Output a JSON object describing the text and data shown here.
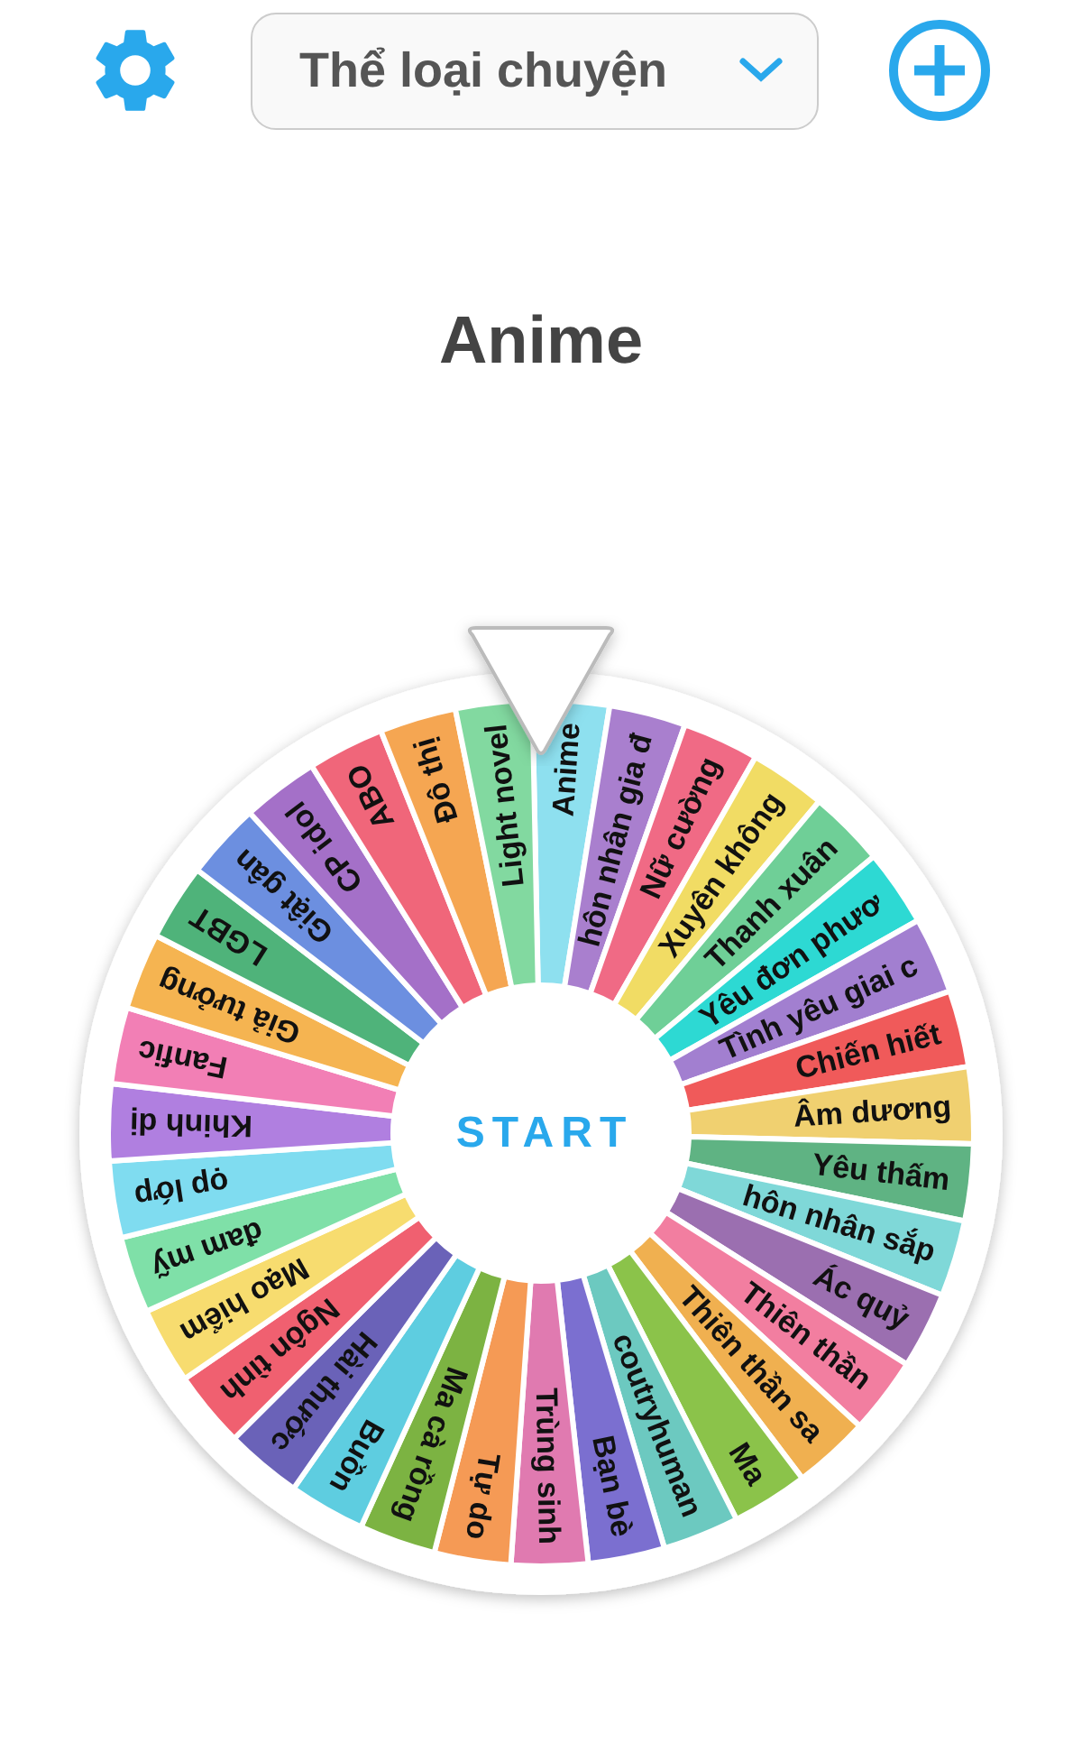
{
  "header": {
    "dropdown": {
      "label": "Thể loại chuyện"
    }
  },
  "result": "Anime",
  "wheel": {
    "start": "START",
    "segments": [
      {
        "label": "Anime",
        "color": "#8ee0ef"
      },
      {
        "label": "hôn nhân gia đ",
        "color": "#a97fce"
      },
      {
        "label": "Nữ cường",
        "color": "#f06a85"
      },
      {
        "label": "Xuyên không",
        "color": "#f1dc64"
      },
      {
        "label": "Thanh xuân",
        "color": "#6fcf97"
      },
      {
        "label": "Yêu đơn phươ",
        "color": "#2dd9d3"
      },
      {
        "label": "Tình yêu giai c",
        "color": "#a27fd0"
      },
      {
        "label": "Chiến hiết",
        "color": "#f05a5a"
      },
      {
        "label": "Âm dương",
        "color": "#f0d070"
      },
      {
        "label": "Yêu thấm",
        "color": "#5fb383"
      },
      {
        "label": "hôn nhân sắp",
        "color": "#7fd8d8"
      },
      {
        "label": "Ác quỷ",
        "color": "#9b6fb0"
      },
      {
        "label": "Thiên thần",
        "color": "#f27ea0"
      },
      {
        "label": "Thiên thần sa",
        "color": "#f0b050"
      },
      {
        "label": "Ma",
        "color": "#8bc34a"
      },
      {
        "label": "coutryhuman",
        "color": "#6cc9c0"
      },
      {
        "label": "Bạn bè",
        "color": "#7b6fd0"
      },
      {
        "label": "Trùng sinh",
        "color": "#e07ab0"
      },
      {
        "label": "Tự do",
        "color": "#f59a55"
      },
      {
        "label": "Ma cà rồng",
        "color": "#7cb342"
      },
      {
        "label": "Buồn",
        "color": "#5ecde0"
      },
      {
        "label": "Hài thước",
        "color": "#6a62b8"
      },
      {
        "label": "Ngôn tình",
        "color": "#f06070"
      },
      {
        "label": "Mạo hiểm",
        "color": "#f7dc6f"
      },
      {
        "label": "đam mỹ",
        "color": "#7fe0a8"
      },
      {
        "label": "ọp lớp",
        "color": "#7fdcf0"
      },
      {
        "label": "Khinh dị",
        "color": "#b07fe0"
      },
      {
        "label": "Fanfic",
        "color": "#f27fb5"
      },
      {
        "label": "Giả tưởng",
        "color": "#f5b451"
      },
      {
        "label": "LGBT",
        "color": "#4fb37a"
      },
      {
        "label": "Giật gân",
        "color": "#6c8fe0"
      },
      {
        "label": "CP idol",
        "color": "#a470c8"
      },
      {
        "label": "ABO",
        "color": "#f0667a"
      },
      {
        "label": "Đô thị",
        "color": "#f5a652"
      },
      {
        "label": "Light novel",
        "color": "#82d9a0"
      }
    ]
  }
}
